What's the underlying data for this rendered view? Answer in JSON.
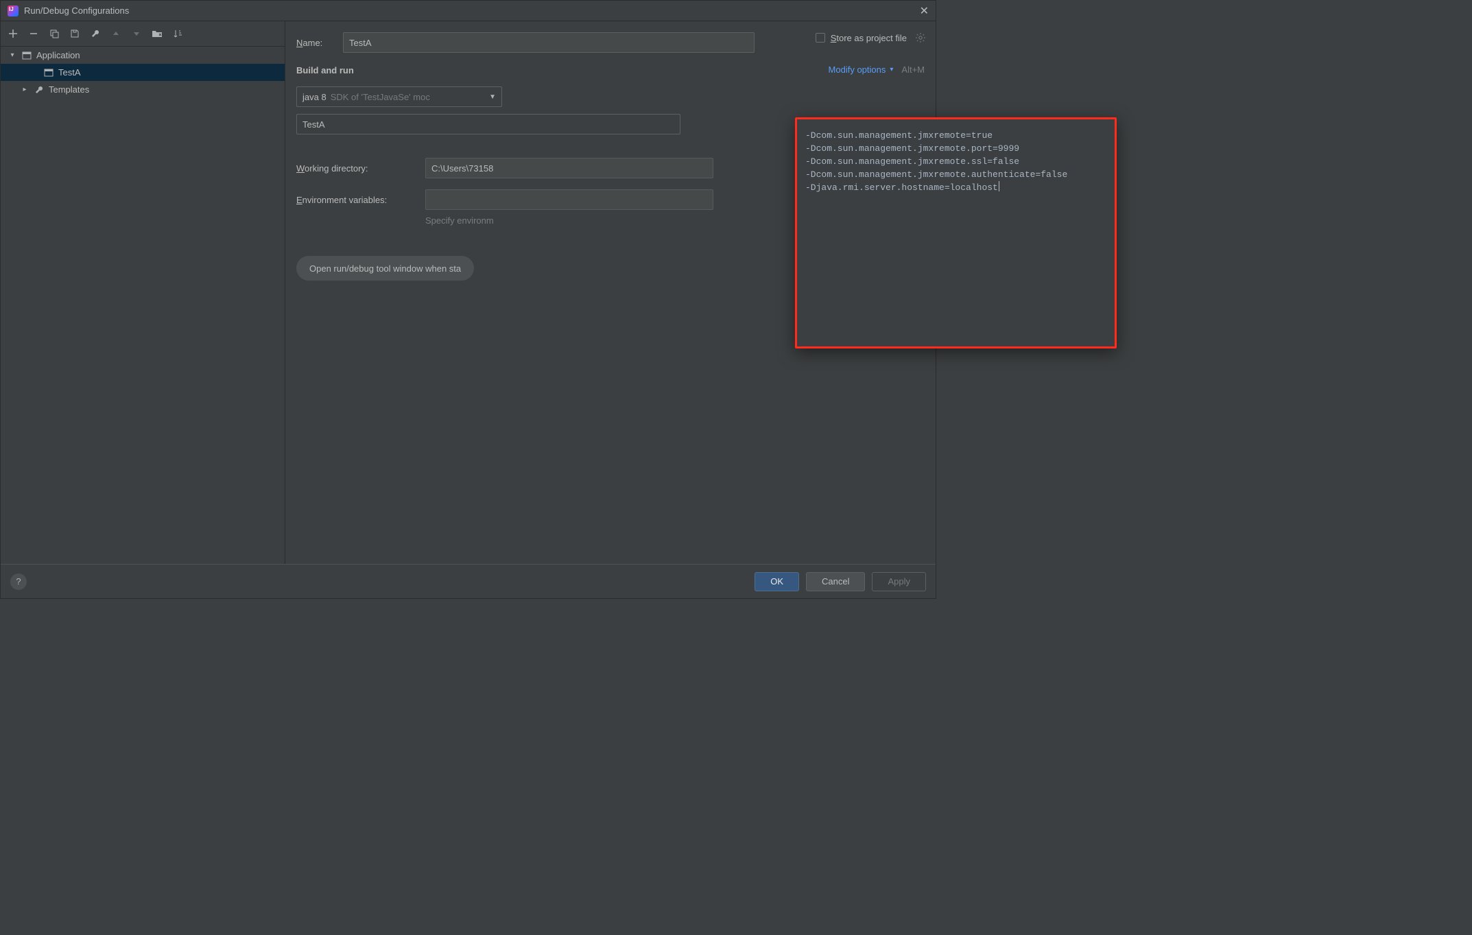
{
  "window": {
    "title": "Run/Debug Configurations"
  },
  "toolbar_icons": {
    "add": "+",
    "remove": "−",
    "copy": "copy",
    "save": "save",
    "wrench": "wrench",
    "up": "up",
    "down": "down",
    "folder": "folder",
    "sort": "sort"
  },
  "tree": {
    "items": [
      {
        "label": "Application",
        "icon": "app"
      },
      {
        "label": "TestA",
        "icon": "run-cfg"
      },
      {
        "label": "Templates",
        "icon": "wrench"
      }
    ]
  },
  "form": {
    "name_label": "Name:",
    "name_value": "TestA",
    "store_label": "Store as project file",
    "section": "Build and run",
    "modify": "Modify options",
    "modify_kb": "Alt+M",
    "jdk_primary": "java 8",
    "jdk_secondary": "SDK of 'TestJavaSe' moc",
    "main_class": "TestA",
    "wd_label": "Working directory:",
    "wd_value": "C:\\Users\\73158",
    "env_label": "Environment variables:",
    "env_hint": "Specify environm",
    "chip": "Open run/debug tool window when sta"
  },
  "vm_options": "-Dcom.sun.management.jmxremote=true\n-Dcom.sun.management.jmxremote.port=9999\n-Dcom.sun.management.jmxremote.ssl=false\n-Dcom.sun.management.jmxremote.authenticate=false\n-Djava.rmi.server.hostname=localhost",
  "buttons": {
    "ok": "OK",
    "cancel": "Cancel",
    "apply": "Apply"
  }
}
